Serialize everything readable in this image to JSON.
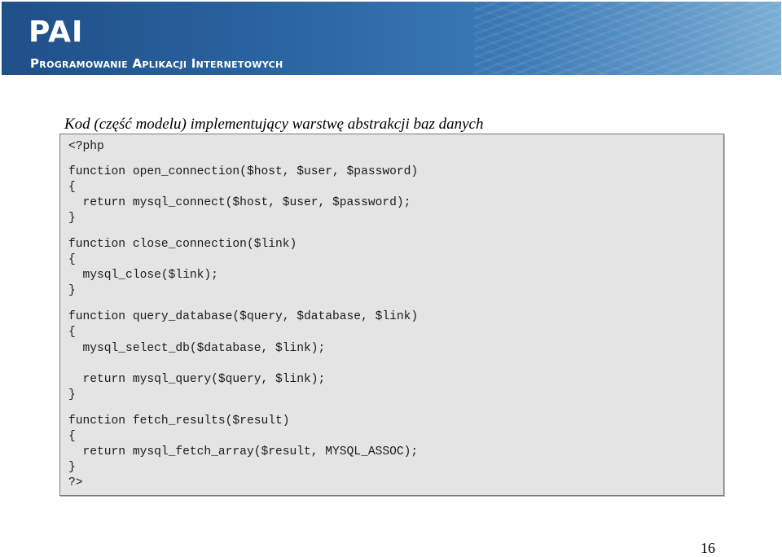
{
  "header": {
    "brand": "PAI",
    "subtitle": "Programowanie Aplikacji Internetowych"
  },
  "caption": "Kod (część modelu) implementujący warstwę  abstrakcji baz danych",
  "code": {
    "lines": [
      "<?php",
      "function open_connection($host, $user, $password)",
      "{",
      "  return mysql_connect($host, $user, $password);",
      "}",
      "function close_connection($link)",
      "{",
      "  mysql_close($link);",
      "}",
      "function query_database($query, $database, $link)",
      "{",
      "  mysql_select_db($database, $link);",
      "  return mysql_query($query, $link);",
      "}",
      "function fetch_results($result)",
      "{",
      "  return mysql_fetch_array($result, MYSQL_ASSOC);",
      "}",
      "?>"
    ]
  },
  "page_number": "16"
}
